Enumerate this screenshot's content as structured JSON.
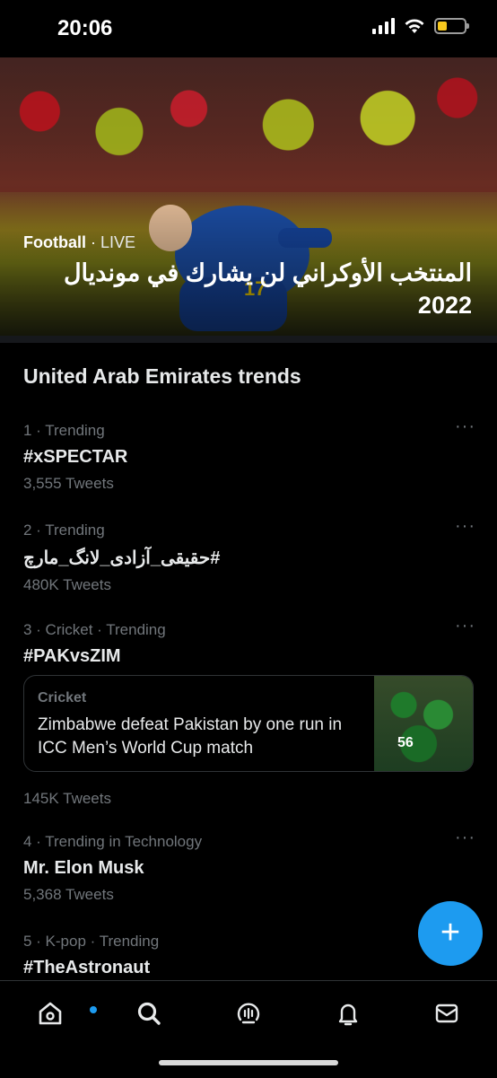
{
  "status": {
    "time": "20:06"
  },
  "hero": {
    "topic": "Football",
    "separator": " · ",
    "live": "LIVE",
    "title": "المنتخب الأوكراني لن يشارك في مونديال 2022"
  },
  "section": {
    "title": "United Arab Emirates trends"
  },
  "trends": [
    {
      "meta": "1 · Trending",
      "name": "#xSPECTAR",
      "count": "3,555 Tweets"
    },
    {
      "meta": "2 · Trending",
      "name": "#حقيقی_آزادی_لانگ_مارچ",
      "count": "480K Tweets"
    },
    {
      "meta": "3 · Cricket · Trending",
      "name": "#PAKvsZIM",
      "count": "145K Tweets"
    },
    {
      "meta": "4 · Trending in Technology",
      "name": "Mr. Elon Musk",
      "count": "5,368 Tweets"
    },
    {
      "meta": "5 · K-pop · Trending",
      "name": "#TheAstronaut",
      "count": ""
    }
  ],
  "more_label": "···",
  "news_card": {
    "category": "Cricket",
    "headline": "Zimbabwe defeat Pakistan by one run in ICC Men’s World Cup match",
    "thumb_text": "56"
  },
  "fab": {
    "label": "+"
  },
  "tab_bar": {
    "icons": [
      "home-icon",
      "search-icon",
      "spaces-icon",
      "notifications-icon",
      "messages-icon"
    ]
  },
  "colors": {
    "accent": "#1d9bf0",
    "background": "#000000",
    "secondary_text": "#71767b"
  }
}
